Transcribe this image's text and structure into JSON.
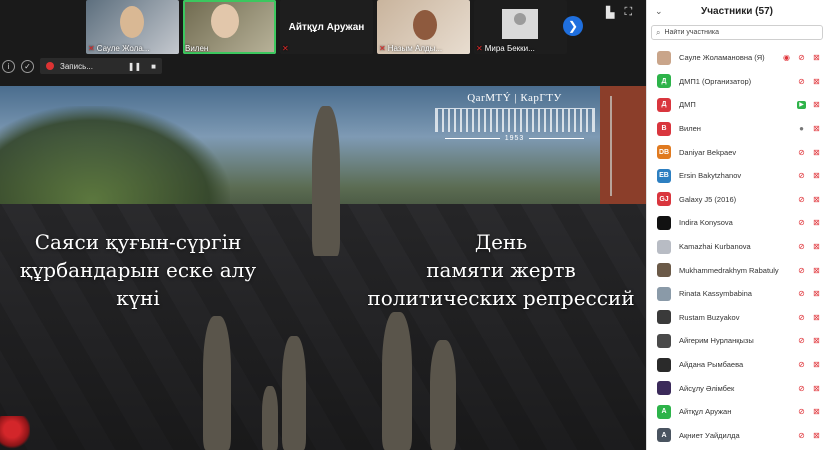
{
  "videos": [
    {
      "name": "Сауле Жола...",
      "muted": true
    },
    {
      "name": "Вилен",
      "muted": false,
      "active": true
    },
    {
      "name": "Айтқұл Аружан",
      "muted": true
    },
    {
      "name": "Назым Алды...",
      "muted": true
    },
    {
      "name": "Мира Бекки...",
      "muted": true
    }
  ],
  "recording": {
    "label": "Запись..."
  },
  "slide": {
    "logo_name": "QarMTÝ | КарГТУ",
    "logo_year": "1953",
    "kz_lines": [
      "Саяси қуғын-сүргін",
      "құрбандарын еске алу",
      "күні"
    ],
    "ru_lines": [
      "День",
      "памяти жертв",
      "политических репрессий"
    ]
  },
  "panel": {
    "title": "Участники (57)",
    "search_placeholder": "Найти участника"
  },
  "participants": [
    {
      "name": "Сауле Жоламановна (Я)",
      "initials": "",
      "color": "#c9a58a",
      "photo": true
    },
    {
      "name": "ДМП1 (Организатор)",
      "initials": "Д",
      "color": "#2db34a"
    },
    {
      "name": "ДМП",
      "initials": "Д",
      "color": "#d9363e"
    },
    {
      "name": "Вилен",
      "initials": "В",
      "color": "#d9363e"
    },
    {
      "name": "Daniyar Bekpaev",
      "initials": "DB",
      "color": "#e07a20"
    },
    {
      "name": "Ersin Bakytzhanov",
      "initials": "EB",
      "color": "#2d7fc1"
    },
    {
      "name": "Galaxy J5 (2016)",
      "initials": "GJ",
      "color": "#d9363e"
    },
    {
      "name": "Indira Konysova",
      "initials": "",
      "color": "#111111"
    },
    {
      "name": "Kamazhai Kurbanova",
      "initials": "",
      "color": "#b8bcc4"
    },
    {
      "name": "Mukhammedrakhym Rabatuly",
      "initials": "",
      "color": "#6b5a48"
    },
    {
      "name": "Rinata Kassymbabina",
      "initials": "",
      "color": "#8a9aa8"
    },
    {
      "name": "Rustam Buzyakov",
      "initials": "",
      "color": "#3a3a3a"
    },
    {
      "name": "Айгерим Нурланқызы",
      "initials": "",
      "color": "#4a4a4a"
    },
    {
      "name": "Айдана Рымбаева",
      "initials": "",
      "color": "#2a2a2a"
    },
    {
      "name": "Айсұлу Әлімбек",
      "initials": "",
      "color": "#3b2a5a"
    },
    {
      "name": "Айтқұл Аружан",
      "initials": "А",
      "color": "#2db34a"
    },
    {
      "name": "Ақниет Уайдилда",
      "initials": "А",
      "color": "#4a5460"
    }
  ]
}
